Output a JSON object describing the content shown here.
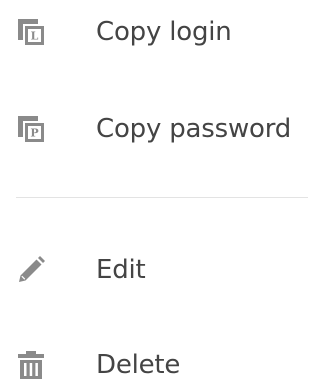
{
  "menu": {
    "items": [
      {
        "label": "Copy login",
        "icon": "copy-login-icon",
        "icon_letter": "L"
      },
      {
        "label": "Copy password",
        "icon": "copy-password-icon",
        "icon_letter": "P"
      },
      {
        "label": "Edit",
        "icon": "pencil-icon"
      },
      {
        "label": "Delete",
        "icon": "trash-icon"
      }
    ]
  },
  "colors": {
    "text": "#444444",
    "icon": "#8a8a8a",
    "divider": "#e3e3e3",
    "background": "#ffffff"
  }
}
